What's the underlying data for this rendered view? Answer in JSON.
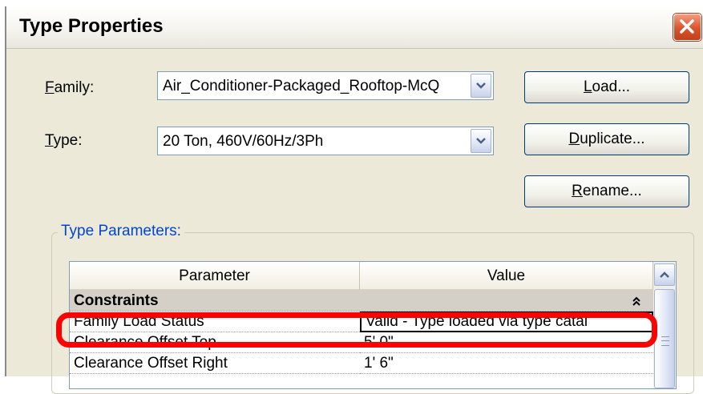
{
  "window": {
    "title": "Type Properties",
    "close_icon": "close-icon"
  },
  "family": {
    "label_prefix": "",
    "label_mnemonic": "F",
    "label_rest": "amily:",
    "value": "Air_Conditioner-Packaged_Rooftop-McQ"
  },
  "type": {
    "label_mnemonic": "T",
    "label_rest": "ype:",
    "value": "20 Ton, 460V/60Hz/3Ph"
  },
  "buttons": {
    "load_mnemonic": "L",
    "load_rest": "oad...",
    "duplicate_mnemonic": "D",
    "duplicate_rest": "uplicate...",
    "rename_mnemonic": "R",
    "rename_rest": "ename..."
  },
  "type_parameters": {
    "group_label": "Type Parameters:",
    "columns": [
      "Parameter",
      "Value"
    ],
    "category": "Constraints",
    "rows": [
      {
        "parameter": "Family Load Status",
        "value": "Valid - Type loaded via type catal"
      },
      {
        "parameter": "Clearance Offset Top",
        "value": "5'  0\""
      },
      {
        "parameter": "Clearance Offset Right",
        "value": "1'  6\""
      }
    ]
  },
  "colors": {
    "highlight": "#ff0000",
    "group_label": "#0046d5",
    "dialog_bg": "#ece9d8"
  }
}
